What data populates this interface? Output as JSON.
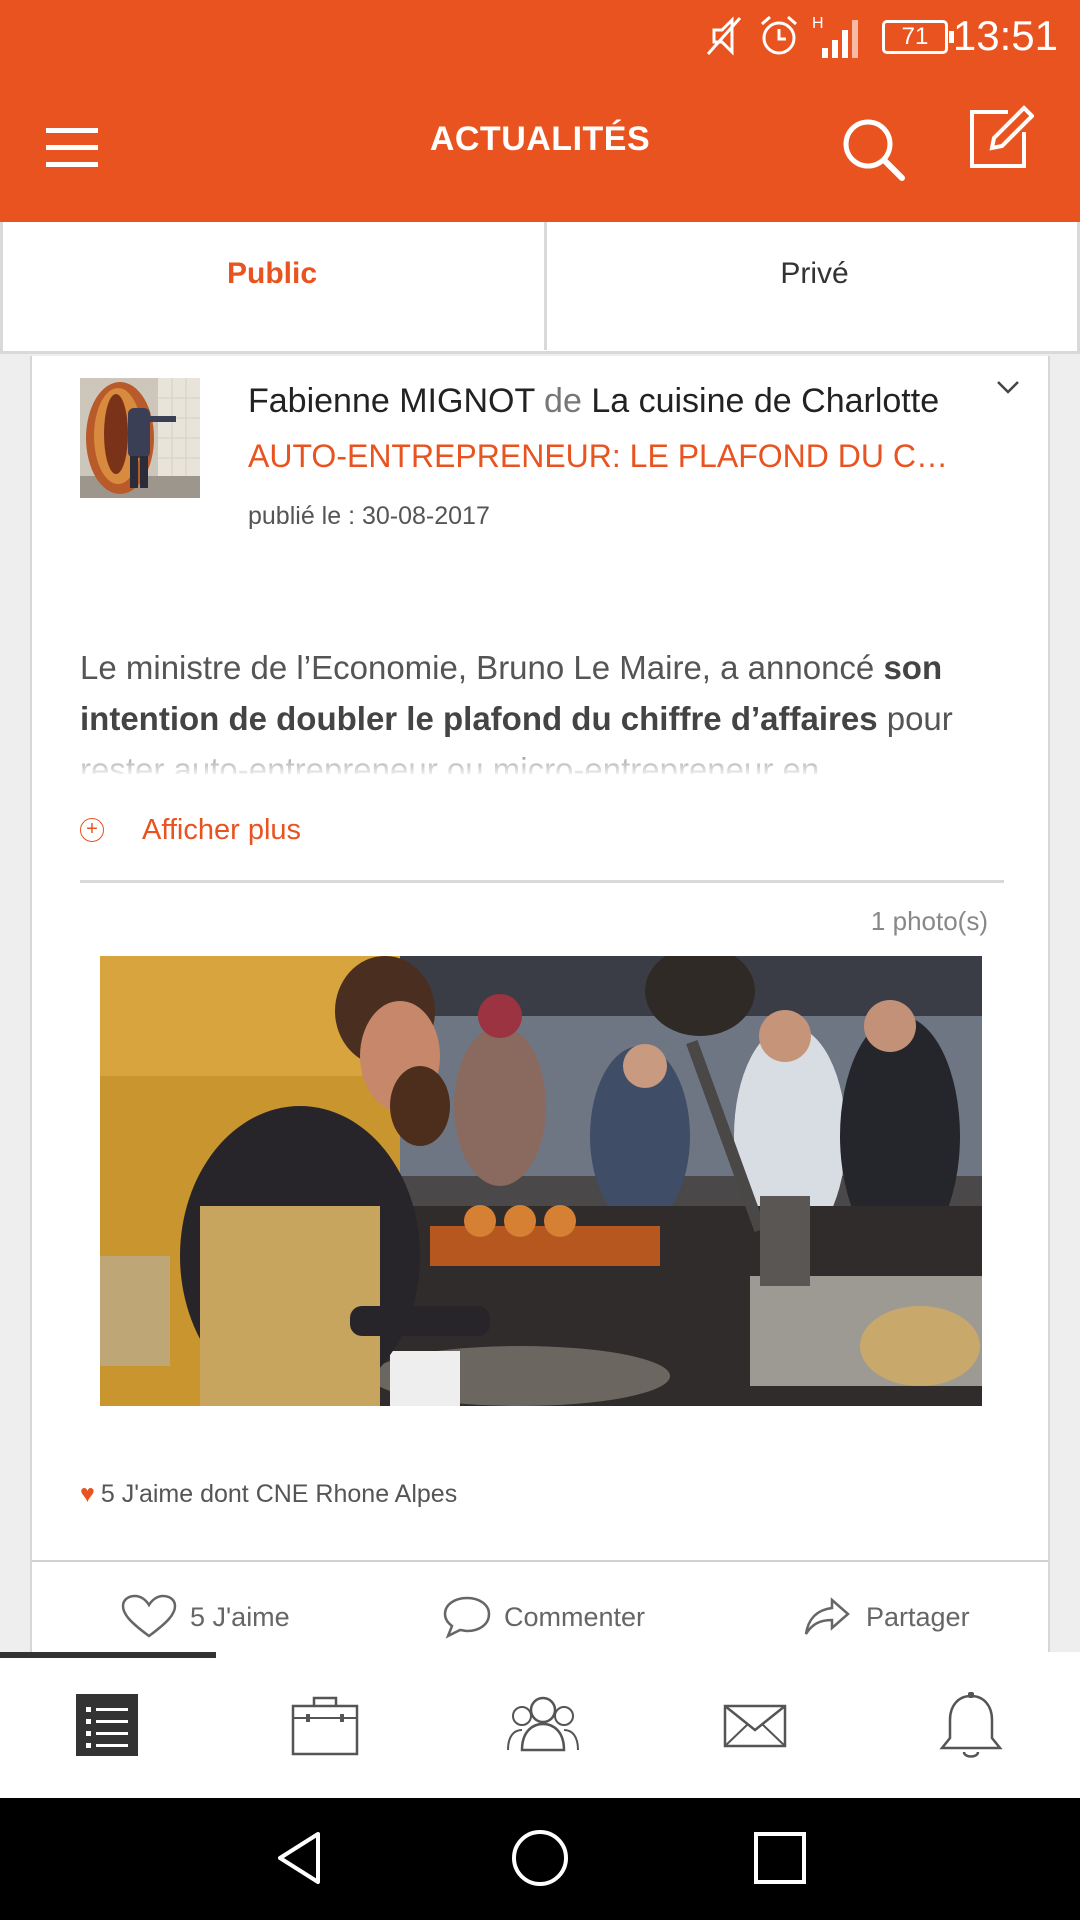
{
  "status_bar": {
    "time": "13:51",
    "battery": "71",
    "network": "H",
    "icons": [
      "mute-icon",
      "alarm-icon",
      "signal-icon"
    ]
  },
  "header": {
    "title": "ACTUALITÉS",
    "icons": [
      "menu-icon",
      "search-icon",
      "edit-icon"
    ],
    "color": "#e8531f"
  },
  "tabs": [
    {
      "label": "Public",
      "active": true
    },
    {
      "label": "Privé",
      "active": false
    }
  ],
  "post": {
    "author": "Fabienne MIGNOT",
    "connector": "de",
    "group": "La cuisine de Charlotte",
    "title": "AUTO-ENTREPRENEUR: LE PLAFOND DU C…",
    "date": "publié le : 30-08-2017",
    "excerpt_start": "Le ministre de l’Economie, Bruno Le Maire, a annoncé ",
    "excerpt_bold": "son intention de doubler le plafond du chiffre d’affaires",
    "excerpt_end": "  pour rester auto-entrepreneur ou micro-entrepreneur en",
    "show_more": "Afficher plus",
    "photo_count": "1 photo(s)",
    "likes_summary": "5 J'aime dont CNE Rhone Alpes"
  },
  "actions": {
    "like": "5 J'aime",
    "comment": "Commenter",
    "share": "Partager"
  },
  "bottom_nav": [
    "feed-list-icon",
    "briefcase-icon",
    "group-icon",
    "mail-icon",
    "bell-icon"
  ],
  "system_nav": [
    "back-icon",
    "home-icon",
    "recents-icon"
  ]
}
